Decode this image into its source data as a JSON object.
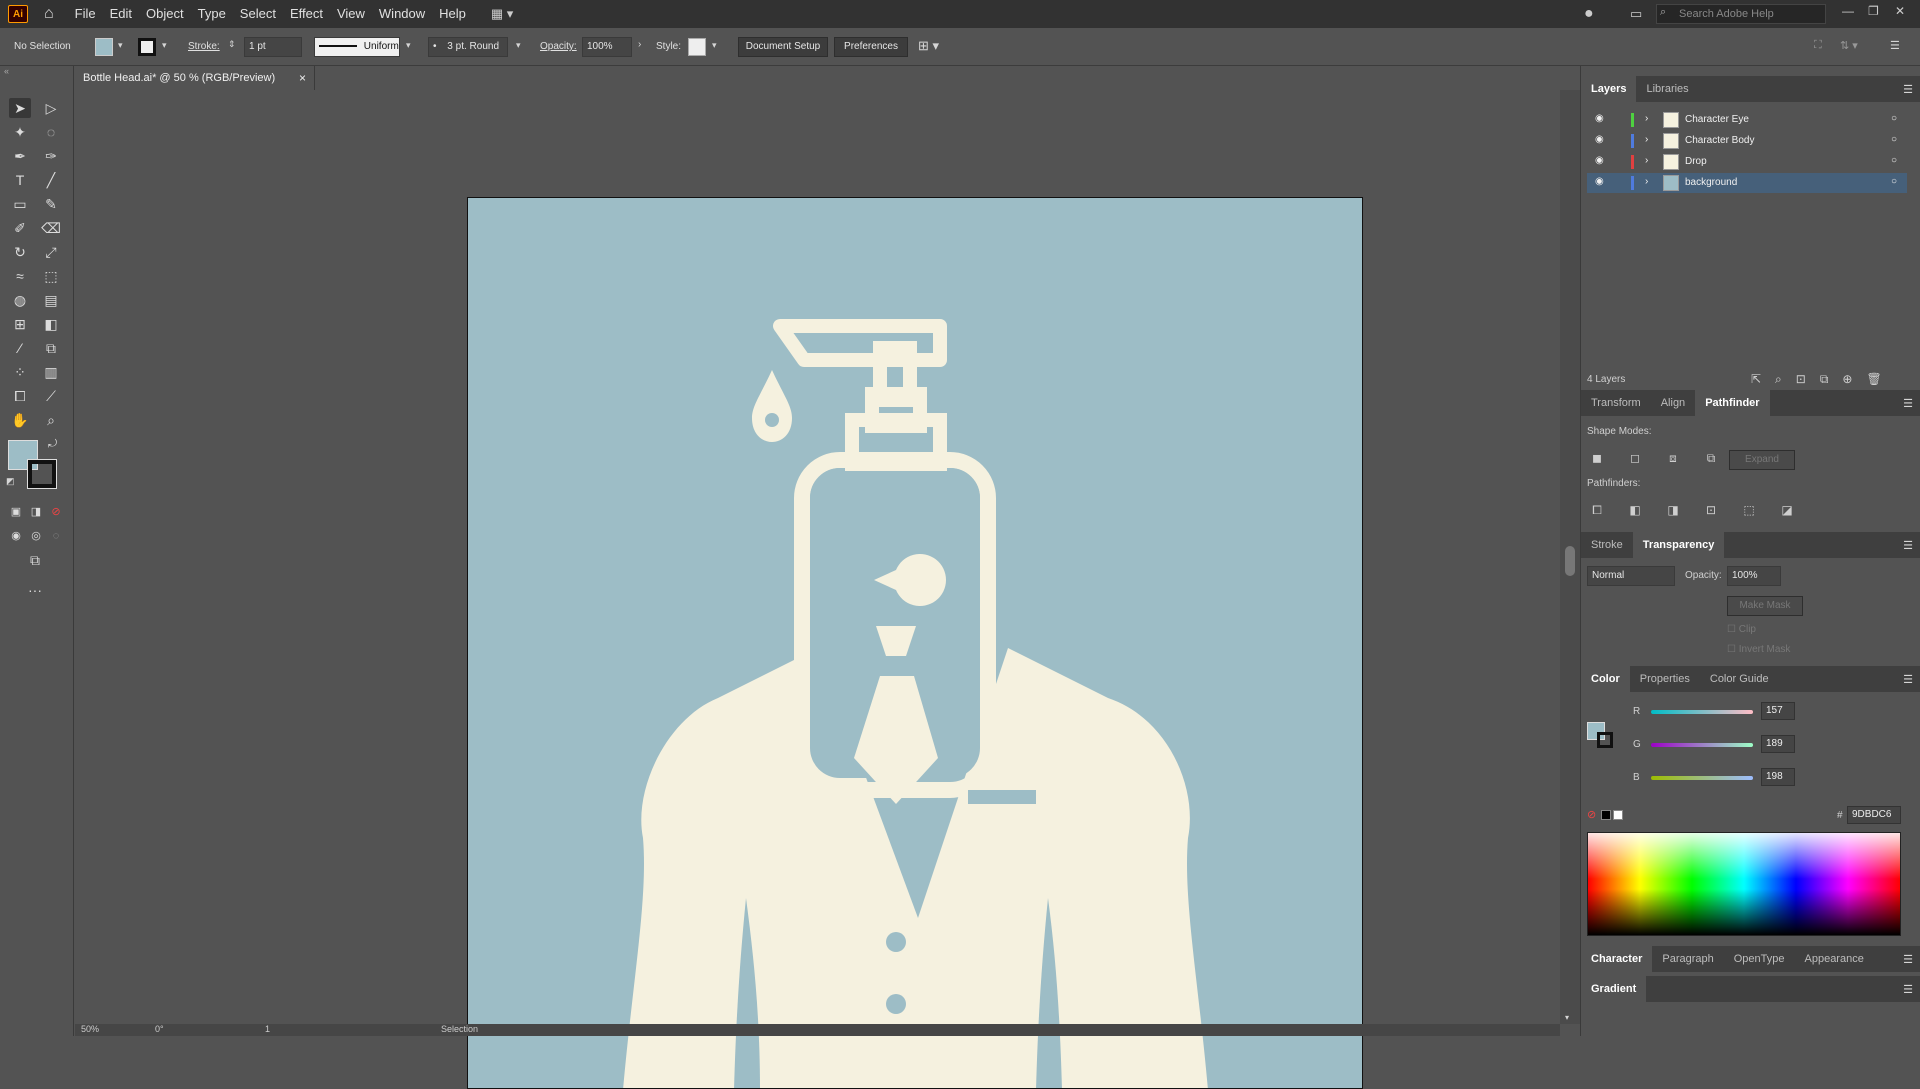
{
  "menu": {
    "logo": "Ai",
    "items": [
      "File",
      "Edit",
      "Object",
      "Type",
      "Select",
      "Effect",
      "View",
      "Window",
      "Help"
    ],
    "search_placeholder": "Search Adobe Help"
  },
  "control": {
    "selection": "No Selection",
    "stroke_label": "Stroke:",
    "stroke_value": "1 pt",
    "profile": "Uniform",
    "brush": "3 pt. Round",
    "opacity_label": "Opacity:",
    "opacity_value": "100%",
    "style_label": "Style:",
    "doc_setup": "Document Setup",
    "preferences": "Preferences"
  },
  "document": {
    "tab_title": "Bottle Head.ai* @ 50 % (RGB/Preview)",
    "close": "×"
  },
  "status": {
    "zoom": "50%",
    "rotation": "0°",
    "artboard": "1",
    "tool": "Selection"
  },
  "layers_panel": {
    "tabs": [
      "Layers",
      "Libraries"
    ],
    "layers": [
      {
        "name": "Character Eye",
        "color": "#4ed040"
      },
      {
        "name": "Character Body",
        "color": "#4f7bde"
      },
      {
        "name": "Drop",
        "color": "#e04040"
      },
      {
        "name": "background",
        "color": "#4f7bde"
      }
    ],
    "count": "4 Layers"
  },
  "pathfinder_panel": {
    "tabs": [
      "Transform",
      "Align",
      "Pathfinder"
    ],
    "shape_modes": "Shape Modes:",
    "expand": "Expand",
    "pathfinders": "Pathfinders:"
  },
  "transparency_panel": {
    "tabs": [
      "Stroke",
      "Transparency"
    ],
    "blend": "Normal",
    "opacity_label": "Opacity:",
    "opacity_value": "100%",
    "make_mask": "Make Mask",
    "clip": "Clip",
    "invert": "Invert Mask"
  },
  "color_panel": {
    "tabs": [
      "Color",
      "Properties",
      "Color Guide"
    ],
    "r_label": "R",
    "r": "157",
    "g_label": "G",
    "g": "189",
    "b_label": "B",
    "b": "198",
    "hex_label": "#",
    "hex": "9DBDC6",
    "fill": "#9dbdc6"
  },
  "bottom_panels": {
    "tabs": [
      "Character",
      "Paragraph",
      "OpenType",
      "Appearance"
    ],
    "gradient": "Gradient"
  },
  "artwork": {
    "background": "#9dbdc6",
    "figure": "#f5f1df"
  }
}
